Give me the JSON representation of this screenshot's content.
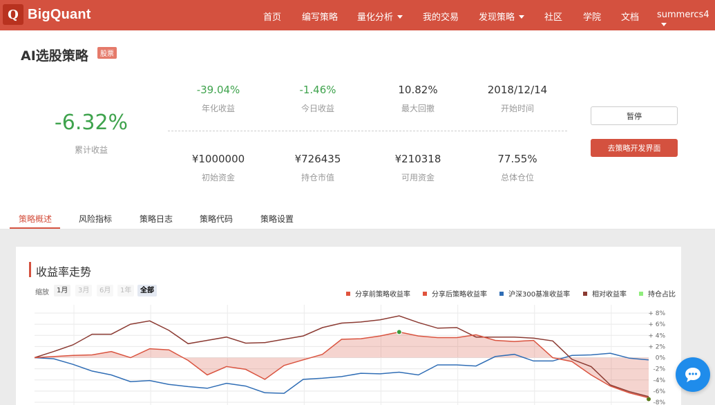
{
  "nav": {
    "brand": "BigQuant",
    "logo_letter": "Q",
    "items": [
      {
        "label": "首页",
        "has_caret": false
      },
      {
        "label": "编写策略",
        "has_caret": false
      },
      {
        "label": "量化分析",
        "has_caret": true
      },
      {
        "label": "我的交易",
        "has_caret": false
      },
      {
        "label": "发现策略",
        "has_caret": true
      },
      {
        "label": "社区",
        "has_caret": false
      },
      {
        "label": "学院",
        "has_caret": false
      },
      {
        "label": "文档",
        "has_caret": false
      },
      {
        "label": "summercs4",
        "has_caret": true
      }
    ]
  },
  "header": {
    "title": "AI选股策略",
    "badge": "股票",
    "cumulative_return": {
      "value": "-6.32%",
      "label": "累计收益"
    },
    "metrics_top": [
      {
        "value": "-39.04%",
        "label": "年化收益",
        "green": true
      },
      {
        "value": "-1.46%",
        "label": "今日收益",
        "green": true
      },
      {
        "value": "10.82%",
        "label": "最大回撤",
        "green": false
      },
      {
        "value": "2018/12/14",
        "label": "开始时间",
        "green": false
      }
    ],
    "metrics_bottom": [
      {
        "value": "¥1000000",
        "label": "初始资金"
      },
      {
        "value": "¥726435",
        "label": "持仓市值"
      },
      {
        "value": "¥210318",
        "label": "可用资金"
      },
      {
        "value": "77.55%",
        "label": "总体仓位"
      }
    ],
    "pause_button": "暂停",
    "dev_button": "去策略开发界面"
  },
  "tabs": [
    {
      "label": "策略概述",
      "active": true
    },
    {
      "label": "风险指标",
      "active": false
    },
    {
      "label": "策略日志",
      "active": false
    },
    {
      "label": "策略代码",
      "active": false
    },
    {
      "label": "策略设置",
      "active": false
    }
  ],
  "chart_panel": {
    "title": "收益率走势",
    "zoom_label": "缩放",
    "zoom_options": [
      {
        "label": "1月",
        "state": "on"
      },
      {
        "label": "3月",
        "state": "off"
      },
      {
        "label": "6月",
        "state": "off"
      },
      {
        "label": "1年",
        "state": "off"
      },
      {
        "label": "全部",
        "state": "sel"
      }
    ]
  },
  "colors": {
    "brand": "#d4513f",
    "positive_green": "#3fa34d",
    "strategy_red": "#d9533f",
    "benchmark_blue": "#2f6db5",
    "relative_brown": "#8b3a32",
    "position_green": "#90ed7d",
    "chat_blue": "#1f8ceb"
  },
  "chart_data": {
    "type": "line",
    "legend": [
      {
        "name": "分享前策略收益率",
        "color": "#e0533d"
      },
      {
        "name": "分享后策略收益率",
        "color": "#e0533d"
      },
      {
        "name": "沪深300基准收益率",
        "color": "#2f6db5"
      },
      {
        "name": "相对收益率",
        "color": "#8b3a32"
      },
      {
        "name": "持仓占比",
        "color": "#90ed7d"
      }
    ],
    "y_ticks": [
      "+ 8%",
      "+ 6%",
      "+ 4%",
      "+ 2%",
      "0%",
      "-2%",
      "-4%",
      "-6%",
      "-8%"
    ],
    "y_tick_values": [
      8,
      6,
      4,
      2,
      0,
      -2,
      -4,
      -6,
      -8
    ],
    "ylim": [
      -8,
      8
    ],
    "grid": true,
    "x_count": 33,
    "series": [
      {
        "role": "strategy",
        "color": "#d9533f",
        "values": [
          0,
          0.2,
          0.4,
          0.5,
          1.1,
          0,
          1.6,
          1.4,
          -0.5,
          -3.1,
          -1.6,
          -2.1,
          -3.9,
          -1.4,
          -0.4,
          0.6,
          3.3,
          3.4,
          3.9,
          4.6,
          3.9,
          3.6,
          3.6,
          4.1,
          3.1,
          2.9,
          3.1,
          0,
          -0.7,
          -3.1,
          -5.1,
          -6.32,
          -7.2
        ]
      },
      {
        "role": "benchmark",
        "color": "#2f6db5",
        "values": [
          0,
          -0.2,
          -1.2,
          -2.4,
          -3.1,
          -4.3,
          -4.1,
          -4.8,
          -5.2,
          -5.5,
          -4.6,
          -5.1,
          -6.3,
          -6.4,
          -3.9,
          -3.7,
          -3.4,
          -2.8,
          -2.9,
          -2.6,
          -3.1,
          -1.3,
          -1.3,
          -1.5,
          0.2,
          0.6,
          -0.6,
          -0.6,
          0.4,
          0.5,
          0.8,
          -0.1,
          -0.4
        ]
      },
      {
        "role": "relative",
        "color": "#8b3a32",
        "values": [
          0,
          1.1,
          2.3,
          4.2,
          4.2,
          6,
          6.6,
          4.9,
          2.5,
          3.1,
          3.7,
          2.6,
          2.7,
          3.3,
          3.9,
          5.4,
          6.2,
          6.4,
          6.8,
          7.5,
          6.3,
          5.3,
          5.4,
          3.7,
          3.7,
          3.7,
          3.5,
          3.0,
          -0.3,
          -1.6,
          -4.9,
          -6.1,
          -7.0
        ]
      }
    ],
    "highlight_point": {
      "series": "strategy",
      "index": 19,
      "color": "#3a9a3a"
    }
  }
}
